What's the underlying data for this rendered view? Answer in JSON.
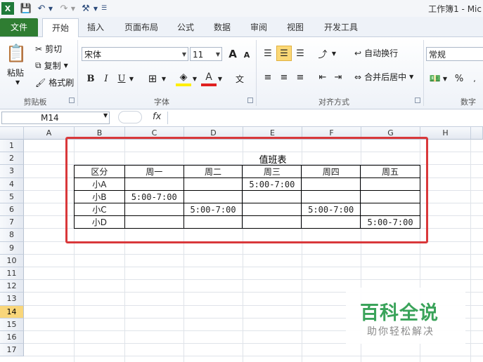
{
  "app": {
    "window_title": "工作簿1 - Mic"
  },
  "quick_access": {
    "undo_icon": "undo-icon",
    "redo_icon": "redo-icon",
    "save_icon": "save-icon"
  },
  "tabs": [
    {
      "label": "文件"
    },
    {
      "label": "开始"
    },
    {
      "label": "插入"
    },
    {
      "label": "页面布局"
    },
    {
      "label": "公式"
    },
    {
      "label": "数据"
    },
    {
      "label": "审阅"
    },
    {
      "label": "视图"
    },
    {
      "label": "开发工具"
    }
  ],
  "ribbon": {
    "clipboard": {
      "paste": "粘贴",
      "cut": "剪切",
      "copy": "复制",
      "format_painter": "格式刷",
      "label": "剪贴板"
    },
    "font": {
      "name": "宋体",
      "size": "11",
      "grow": "A",
      "shrink": "A",
      "bold": "B",
      "italic": "I",
      "underline": "U",
      "label": "字体"
    },
    "alignment": {
      "wrap": "自动换行",
      "merge": "合并后居中",
      "label": "对齐方式"
    },
    "number": {
      "format": "常规",
      "percent": "%",
      "label": "数字"
    }
  },
  "formula_bar": {
    "name_box": "M14",
    "fx": "fx",
    "value": ""
  },
  "columns": [
    "A",
    "B",
    "C",
    "D",
    "E",
    "F",
    "G",
    "H"
  ],
  "rows": [
    "1",
    "2",
    "3",
    "4",
    "5",
    "6",
    "7",
    "8",
    "9",
    "10",
    "11",
    "12",
    "13",
    "14",
    "15",
    "16",
    "17"
  ],
  "active_row": "14",
  "duty": {
    "title": "值班表",
    "header": [
      "区分",
      "周一",
      "周二",
      "周三",
      "周四",
      "周五"
    ],
    "rows": [
      [
        "小A",
        "",
        "",
        "5:00-7:00",
        "",
        ""
      ],
      [
        "小B",
        "5:00-7:00",
        "",
        "",
        "",
        ""
      ],
      [
        "小C",
        "",
        "5:00-7:00",
        "",
        "5:00-7:00",
        ""
      ],
      [
        "小D",
        "",
        "",
        "",
        "",
        "5:00-7:00"
      ]
    ]
  },
  "watermark": {
    "main": "百科全说",
    "sub": "助你轻松解决"
  },
  "colors": {
    "file_tab": "#2f7d32",
    "highlight": "#d9383a",
    "active_row": "#f9d67a",
    "watermark": "#3aa35a"
  }
}
